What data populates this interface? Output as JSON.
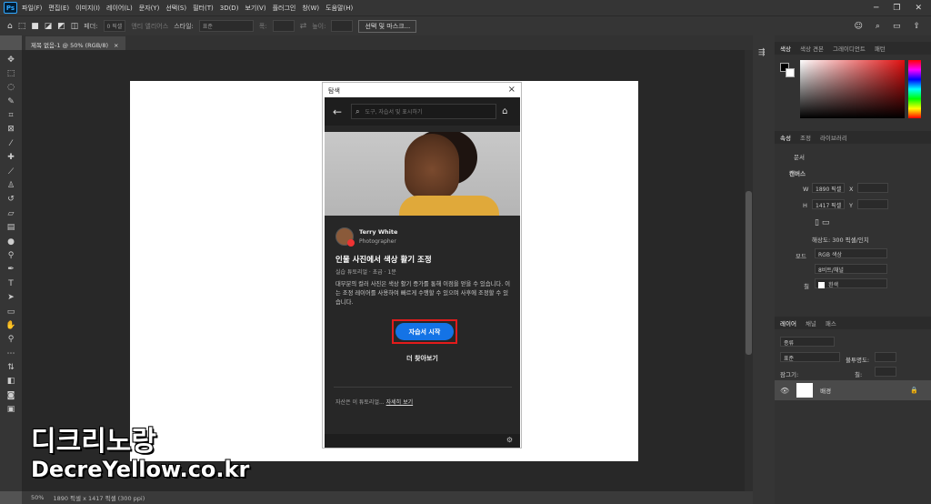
{
  "app": {
    "logo": "Ps"
  },
  "menu": [
    "파일(F)",
    "편집(E)",
    "이미지(I)",
    "레이어(L)",
    "문자(Y)",
    "선택(S)",
    "필터(T)",
    "3D(D)",
    "보기(V)",
    "플러그인",
    "창(W)",
    "도움말(H)"
  ],
  "options": {
    "feather_label": "페더:",
    "feather_value": "0 픽셀",
    "antialias": "앤티 앨리어스",
    "style_label": "스타일:",
    "style_value": "표준",
    "width_label": "폭:",
    "height_label": "높이:",
    "select_mask_button": "선택 및 마스크..."
  },
  "document": {
    "tab_title": "제목 없음-1 @ 50% (RGB/8)",
    "close": "×"
  },
  "status": {
    "zoom": "50%",
    "info": "1890 픽셀 x 1417 픽셀 (300 ppi)"
  },
  "panels": {
    "color_tabs": [
      "색상",
      "색상 견본",
      "그레이디언트",
      "패턴"
    ],
    "props_tabs": [
      "속성",
      "조정",
      "라이브러리"
    ],
    "props": {
      "doc_label": "문서",
      "canvas_label": "캔버스",
      "w_label": "W",
      "w_value": "1890 픽셀",
      "h_label": "H",
      "h_value": "1417 픽셀",
      "x_label": "X",
      "y_label": "Y",
      "resolution": "해상도: 300 픽셀/인치",
      "mode_label": "모드",
      "mode_value": "RGB 색상",
      "depth_value": "8비트/채널",
      "fill_label": "칠",
      "fill_value": "흰색"
    },
    "layers_tabs": [
      "레이어",
      "채널",
      "패스"
    ],
    "layers": {
      "kind": "종류",
      "blend": "표준",
      "opacity_label": "불투명도:",
      "lock_label": "잠그기:",
      "fill_label": "칠:",
      "background_layer": "배경"
    }
  },
  "dialog": {
    "title": "탐색",
    "close": "×",
    "search_placeholder": "도구, 자습서 및 표시하기",
    "author_name": "Terry White",
    "author_role": "Photographer",
    "tutorial_title": "인물 사진에서 색상 활기 조정",
    "tutorial_meta": "실습 튜토리얼 · 초급 · 1분",
    "tutorial_desc": "대부분의 컬러 사진은 색상 활기 증가를 통해 이점을 얻을 수 있습니다. 이는 조정 레이어를 사용하여 빠르게 수행할 수 있으며 사후에 조정할 수 있습니다.",
    "start_button": "자습서 시작",
    "more_button": "더 찾아보기",
    "footer_text": "자산은 이 튜토리얼...",
    "footer_link": "자세히 보기"
  },
  "watermark": {
    "line1": "디크리노랑",
    "line2": "DecreYellow.co.kr"
  },
  "colors": {
    "accent": "#1473e6",
    "highlight": "#e31b1b",
    "bg": "#535353"
  }
}
